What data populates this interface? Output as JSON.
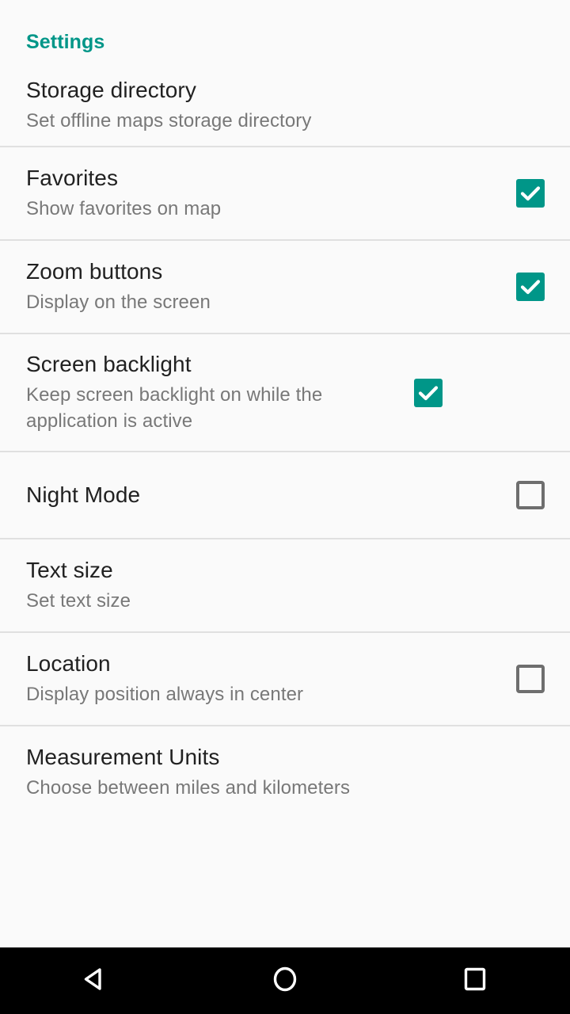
{
  "screen": {
    "title": "Settings",
    "background_color": "#fafafa",
    "accent_color": "#009688",
    "divider_color": "#e0e0e0"
  },
  "preferences": [
    {
      "name": "storage-directory",
      "title": "Storage directory",
      "summary": "Set offline maps storage directory",
      "widget": "none"
    },
    {
      "name": "favorites",
      "title": "Favorites",
      "summary": "Show favorites on map",
      "widget": "checkbox",
      "checked": true
    },
    {
      "name": "zoom-buttons",
      "title": "Zoom buttons",
      "summary": "Display on the screen",
      "widget": "checkbox",
      "checked": true
    },
    {
      "name": "screen-backlight",
      "title": "Screen backlight",
      "summary": "Keep screen backlight on while the application is active",
      "widget": "checkbox",
      "checked": true
    },
    {
      "name": "night-mode",
      "title": "Night Mode",
      "summary": "",
      "widget": "checkbox",
      "checked": false
    },
    {
      "name": "text-size",
      "title": "Text size",
      "summary": "Set text size",
      "widget": "none"
    },
    {
      "name": "location",
      "title": "Location",
      "summary": "Display position always in center",
      "widget": "checkbox",
      "checked": false
    },
    {
      "name": "measurement-units",
      "title": "Measurement Units",
      "summary": "Choose between miles and kilometers",
      "widget": "none"
    }
  ],
  "navbar": {
    "back_label": "back-triangle-icon",
    "home_label": "home-circle-icon",
    "recents_label": "recents-square-icon"
  }
}
